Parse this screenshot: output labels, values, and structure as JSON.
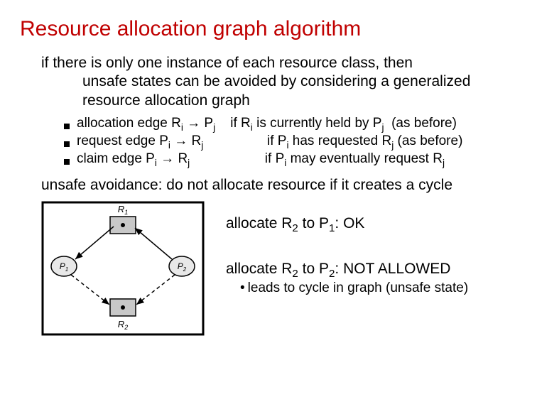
{
  "title": "Resource allocation graph algorithm",
  "intro_line1": "if there is only one instance of each resource class, then",
  "intro_line2": "unsafe states can be avoided by considering a generalized",
  "intro_line3": "resource allocation graph",
  "bullets": {
    "b1_left": "allocation edge R",
    "b1_i": "i",
    "b1_arrow": " → P",
    "b1_j": "j",
    "b1_gap": "    ",
    "b1_right": "if R",
    "b1_i2": "i",
    "b1_mid": " is currently held by P",
    "b1_j2": "j",
    "b1_end": "  (as before)",
    "b2_left": "request edge P",
    "b2_i": "i",
    "b2_arrow": " → R",
    "b2_j": "j",
    "b2_gap": "                 ",
    "b2_right": "if P",
    "b2_i2": "i",
    "b2_mid": " has requested R",
    "b2_j2": "j",
    "b2_end": " (as before)",
    "b3_left": "claim edge P",
    "b3_i": "i",
    "b3_arrow": " → R",
    "b3_j": "j",
    "b3_gap": "                    ",
    "b3_right": "if P",
    "b3_i2": "i",
    "b3_mid": " may eventually request R",
    "b3_j2": "j"
  },
  "avoidance": "unsafe avoidance: do not allocate resource if it creates a cycle",
  "graph": {
    "R1": "R",
    "R1_sub": "1",
    "R2": "R",
    "R2_sub": "2",
    "P1": "P",
    "P1_sub": "1",
    "P2": "P",
    "P2_sub": "2"
  },
  "alloc1_a": "allocate R",
  "alloc1_sub": "2",
  "alloc1_b": " to P",
  "alloc1_sub2": "1",
  "alloc1_c": ":  OK",
  "alloc2_a": "allocate R",
  "alloc2_sub": "2",
  "alloc2_b": " to P",
  "alloc2_sub2": "2",
  "alloc2_c": ":  NOT ALLOWED",
  "note_bullet": "•",
  "note": "leads to cycle in graph (unsafe state)"
}
